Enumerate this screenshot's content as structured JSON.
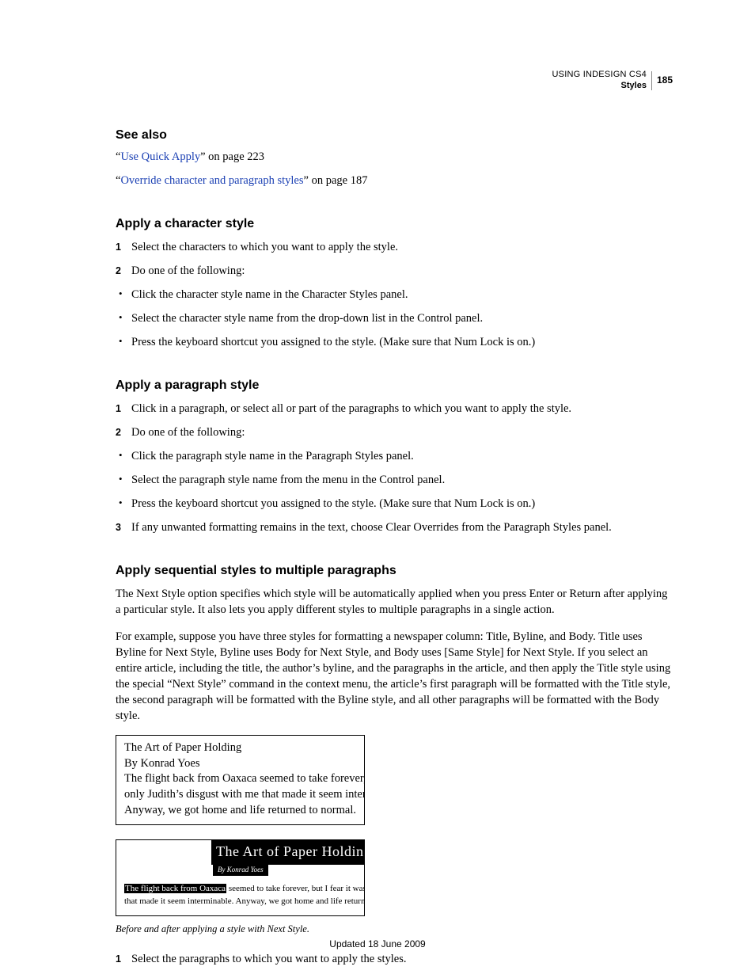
{
  "header": {
    "using": "USING INDESIGN CS4",
    "section": "Styles",
    "page_number": "185"
  },
  "see_also": {
    "heading": "See also",
    "links": [
      {
        "pre": "“",
        "text": "Use Quick Apply",
        "post": "” on page 223"
      },
      {
        "pre": "“",
        "text": "Override character and paragraph styles",
        "post": "” on page 187"
      }
    ]
  },
  "char_style": {
    "heading": "Apply a character style",
    "steps": [
      "Select the characters to which you want to apply the style.",
      "Do one of the following:"
    ],
    "bullets": [
      "Click the character style name in the Character Styles panel.",
      "Select the character style name from the drop-down list in the Control panel.",
      "Press the keyboard shortcut you assigned to the style. (Make sure that Num Lock is on.)"
    ]
  },
  "para_style": {
    "heading": "Apply a paragraph style",
    "steps": [
      "Click in a paragraph, or select all or part of the paragraphs to which you want to apply the style.",
      "Do one of the following:"
    ],
    "bullets": [
      "Click the paragraph style name in the Paragraph Styles panel.",
      "Select the paragraph style name from the menu in the Control panel.",
      "Press the keyboard shortcut you assigned to the style. (Make sure that Num Lock is on.)"
    ],
    "step3": "If any unwanted formatting remains in the text, choose Clear Overrides from the Paragraph Styles panel."
  },
  "seq_styles": {
    "heading": "Apply sequential styles to multiple paragraphs",
    "p1": "The Next Style option specifies which style will be automatically applied when you press Enter or Return after applying a particular style. It also lets you apply different styles to multiple paragraphs in a single action.",
    "p2": "For example, suppose you have three styles for formatting a newspaper column: Title, Byline, and Body. Title uses Byline for Next Style, Byline uses Body for Next Style, and Body uses [Same Style] for Next Style. If you select an entire article, including the title, the author’s byline, and the paragraphs in the article, and then apply the Title style using the special “Next Style” command in the context menu, the article’s first paragraph will be formatted with the Title style, the second paragraph will be formatted with the Byline style, and all other paragraphs will be formatted with the Body style.",
    "figure": {
      "before": {
        "l1": "The Art of Paper Holding",
        "l2": "By Konrad Yoes",
        "l3": "The flight back from Oaxaca seemed to take forever, but I fear it was",
        "l4": "only Judith’s disgust with me that made it seem interminable.",
        "l5": "Anyway, we got home and life returned to normal."
      },
      "after": {
        "title": "The Art of Paper Holding",
        "byline": "By Konrad Yoes",
        "body_hl": "The flight back from Oaxaca",
        "body_rest1": " seemed to take forever, but I fear it was only Judith’s disgust with me",
        "body_rest2": "that made it seem interminable. Anyway, we got home and life returned to normal."
      },
      "caption": "Before and after applying a style with Next Style."
    },
    "step1": "Select the paragraphs to which you want to apply the styles."
  },
  "footer": "Updated 18 June 2009"
}
